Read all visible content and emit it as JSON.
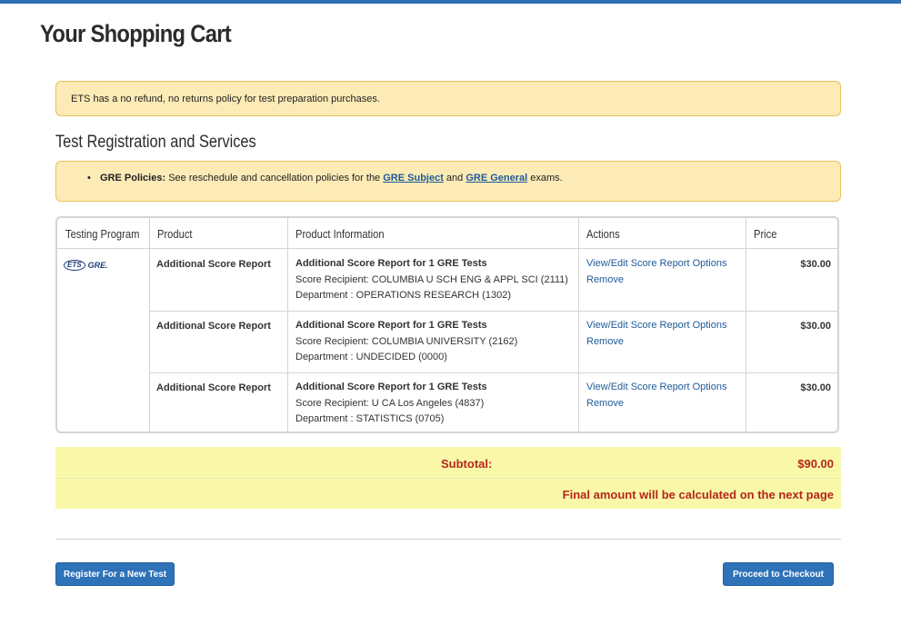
{
  "page": {
    "title": "Your Shopping Cart"
  },
  "notices": {
    "refund": "ETS has a no refund, no returns policy for test preparation purchases.",
    "policies": {
      "label": "GRE Policies:",
      "text": " See reschedule and cancellation policies for the ",
      "link1": "GRE Subject",
      "mid": " and ",
      "link2": "GRE General",
      "end": " exams."
    }
  },
  "section": {
    "title": "Test Registration and Services"
  },
  "table": {
    "headers": [
      "Testing Program",
      "Product",
      "Product Information",
      "Actions",
      "Price"
    ],
    "program_logo": {
      "ets": "ETS",
      "gre": "GRE."
    },
    "rows": [
      {
        "product": "Additional Score Report",
        "info_title": "Additional Score Report for 1 GRE Tests",
        "recipient": "Score Recipient: COLUMBIA U SCH ENG & APPL SCI (2111)",
        "department": "Department : OPERATIONS RESEARCH (1302)",
        "action_edit": "View/Edit Score Report Options",
        "action_remove": "Remove",
        "price": "$30.00"
      },
      {
        "product": "Additional Score Report",
        "info_title": "Additional Score Report for 1 GRE Tests",
        "recipient": "Score Recipient: COLUMBIA UNIVERSITY (2162)",
        "department": "Department : UNDECIDED (0000)",
        "action_edit": "View/Edit Score Report Options",
        "action_remove": "Remove",
        "price": "$30.00"
      },
      {
        "product": "Additional Score Report",
        "info_title": "Additional Score Report for 1 GRE Tests",
        "recipient": "Score Recipient: U CA Los Angeles (4837)",
        "department": "Department : STATISTICS (0705)",
        "action_edit": "View/Edit Score Report Options",
        "action_remove": "Remove",
        "price": "$30.00"
      }
    ]
  },
  "totals": {
    "subtotal_label": "Subtotal:",
    "subtotal_value": "$90.00",
    "final_note": "Final amount will be calculated on the next page"
  },
  "buttons": {
    "register": "Register For a New Test",
    "checkout": "Proceed to Checkout"
  },
  "colors": {
    "accent": "#2e72b8",
    "notice_bg": "#fcebb6",
    "subtotal_bg": "#f9f8a8",
    "total_text": "#b5271b"
  }
}
